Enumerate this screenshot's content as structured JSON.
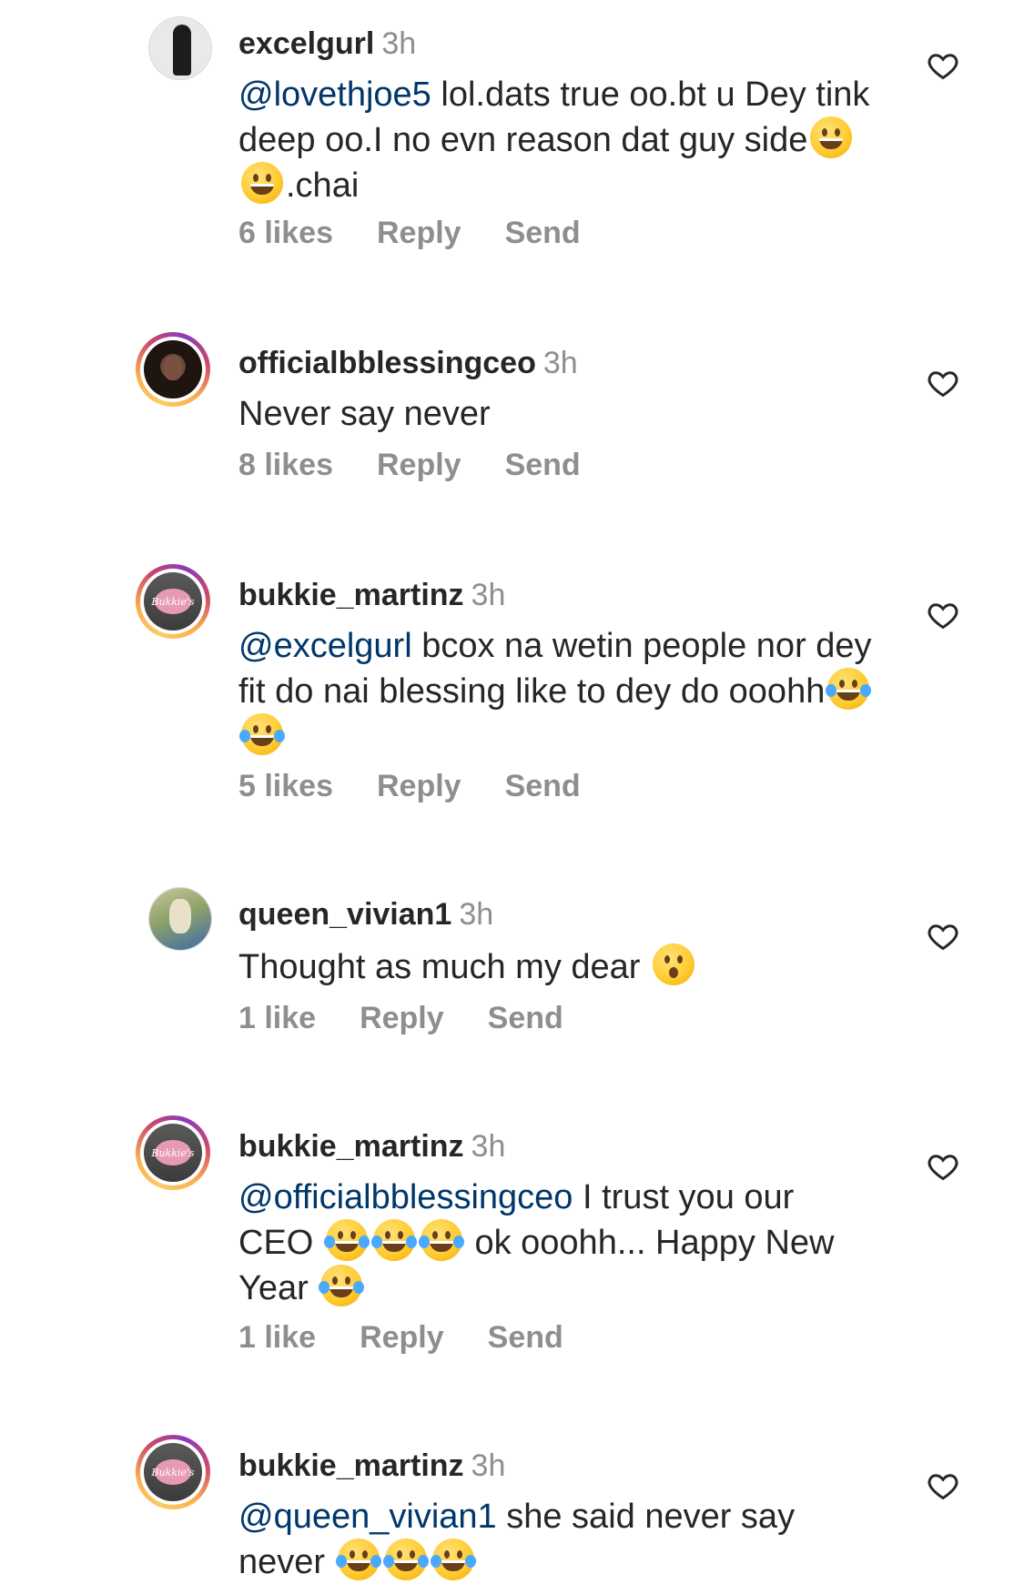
{
  "comments": [
    {
      "username": "excelgurl",
      "time": "3h",
      "mention": "@lovethjoe5",
      "text_1": " lol.dats true oo.bt u Dey tink deep oo.I no evn reason dat guy side",
      "text_2": ".chai",
      "likes": "6 likes",
      "reply": "Reply",
      "send": "Send"
    },
    {
      "username": "officialbblessingceo",
      "time": "3h",
      "text_1": "Never say never",
      "likes": "8 likes",
      "reply": "Reply",
      "send": "Send"
    },
    {
      "username": "bukkie_martinz",
      "time": "3h",
      "mention": "@excelgurl",
      "text_1": " bcox na wetin people nor dey fit do nai blessing like to dey do ooohh",
      "likes": "5 likes",
      "reply": "Reply",
      "send": "Send"
    },
    {
      "username": "queen_vivian1",
      "time": "3h",
      "text_1": "Thought as much my dear ",
      "likes": "1 like",
      "reply": "Reply",
      "send": "Send"
    },
    {
      "username": "bukkie_martinz",
      "time": "3h",
      "mention": "@officialbblessingceo",
      "text_1": " I trust you our CEO ",
      "text_2": " ok ooohh... Happy New Year ",
      "likes": "1 like",
      "reply": "Reply",
      "send": "Send"
    },
    {
      "username": "bukkie_martinz",
      "time": "3h",
      "mention": "@queen_vivian1",
      "text_1": " she said never say never "
    }
  ],
  "avatar_logo_text": "Bukkie's",
  "icons": {
    "like": "heart-icon",
    "grin": "grinning-face-emoji",
    "laugh": "face-with-tears-of-joy-emoji",
    "wow": "hushed-face-emoji"
  },
  "colors": {
    "text": "#262626",
    "secondary": "#8e8e8e",
    "mention": "#00376b"
  }
}
